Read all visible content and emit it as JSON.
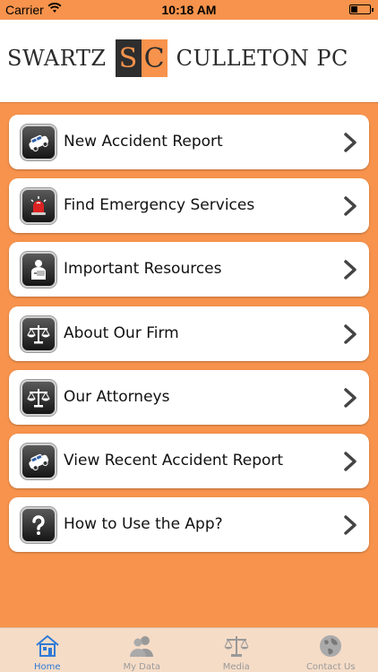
{
  "status_bar": {
    "carrier": "Carrier",
    "time": "10:18 AM",
    "battery_level": 0.35
  },
  "header": {
    "logo_left": "SWARTZ",
    "logo_s": "S",
    "logo_c": "C",
    "logo_right": "CULLETON PC"
  },
  "menu": {
    "items": [
      {
        "label": "New Accident Report",
        "icon": "car-crash-icon"
      },
      {
        "label": "Find Emergency Services",
        "icon": "siren-icon"
      },
      {
        "label": "Important Resources",
        "icon": "injured-person-icon"
      },
      {
        "label": "About Our Firm",
        "icon": "scales-of-justice-icon"
      },
      {
        "label": "Our Attorneys",
        "icon": "scales-of-justice-icon"
      },
      {
        "label": "View Recent Accident Report",
        "icon": "car-crash-icon"
      },
      {
        "label": "How to Use the App?",
        "icon": "question-mark-icon"
      }
    ]
  },
  "tabbar": {
    "tabs": [
      {
        "label": "Home",
        "icon": "home-icon",
        "active": true
      },
      {
        "label": "My Data",
        "icon": "users-icon",
        "active": false
      },
      {
        "label": "Media",
        "icon": "scales-icon",
        "active": false
      },
      {
        "label": "Contact Us",
        "icon": "globe-icon",
        "active": false
      }
    ]
  },
  "colors": {
    "background": "#f7934c",
    "card": "#ffffff",
    "tab_active": "#2f7ad6",
    "tab_inactive": "#9a9a9a",
    "tabbar_bg": "#f5dcc7"
  }
}
